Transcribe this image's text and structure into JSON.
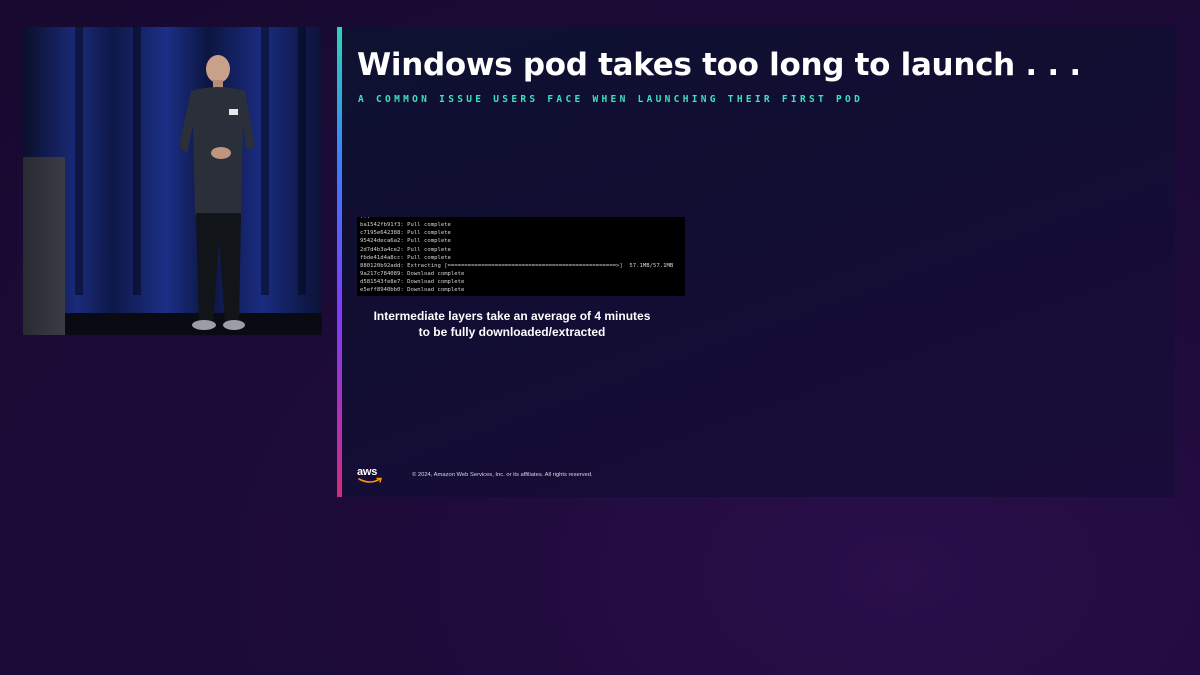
{
  "slide": {
    "title": "Windows pod takes too long to launch . . .",
    "subtitle": "A COMMON ISSUE USERS FACE WHEN LAUNCHING THEIR FIRST POD",
    "terminal_lines": [
      "ba1542fb91f3: Pull complete",
      "c7195e642388: Pull complete",
      "95424deca6a2: Pull complete",
      "2d7d4b3a4ce2: Pull complete",
      "fbde41d4a8cc: Pull complete",
      "880120b92add: Extracting [==================================================>]  57.1MB/57.1MB",
      "9a217c784089: Download complete",
      "d581543fe8e7: Download complete",
      "e5eff8940bb0: Download complete"
    ],
    "caption": "Intermediate layers take an average of 4 minutes to be fully downloaded/extracted",
    "logo_text": "aws",
    "copyright": "© 2024, Amazon Web Services, Inc. or its affiliates. All rights reserved."
  },
  "colors": {
    "background": "#1e0b3a",
    "slide_background": "#0f1030",
    "title": "#ffffff",
    "subtitle": "#3fe0c0",
    "terminal_bg": "#000000",
    "terminal_text": "#d4d4d4",
    "logo_smile": "#ff9900"
  },
  "icons": {
    "logo": "aws-logo",
    "smile": "aws-smile-icon"
  }
}
